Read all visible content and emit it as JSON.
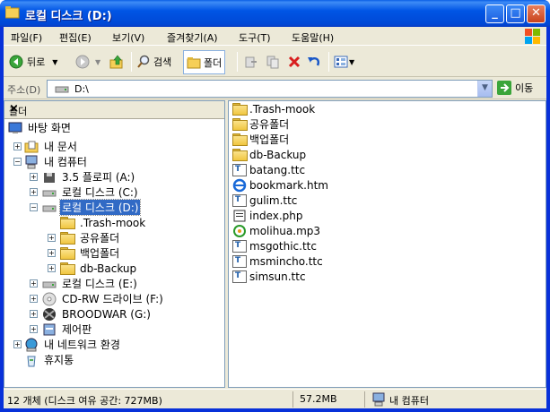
{
  "window": {
    "title": "로컬 디스크 (D:)"
  },
  "menu": [
    "파일(F)",
    "편집(E)",
    "보기(V)",
    "즐겨찾기(A)",
    "도구(T)",
    "도움말(H)"
  ],
  "toolbar": {
    "back": "뒤로",
    "search": "검색",
    "folders": "폴더"
  },
  "address": {
    "label": "주소(D)",
    "value": "D:\\",
    "go": "이동"
  },
  "folders_pane": {
    "title": "폴더"
  },
  "tree": [
    {
      "label": "바탕 화면",
      "icon": "desktop-icon"
    },
    {
      "label": "내 문서",
      "icon": "my-documents-icon"
    },
    {
      "label": "내 컴퓨터",
      "icon": "my-computer-icon"
    },
    {
      "label": "3.5 플로피 (A:)",
      "icon": "floppy-icon"
    },
    {
      "label": "로컬 디스크 (C:)",
      "icon": "drive-icon"
    },
    {
      "label": "로컬 디스크 (D:)",
      "icon": "drive-icon"
    },
    {
      "label": ".Trash-mook",
      "icon": "folder-icon"
    },
    {
      "label": "공유폴더",
      "icon": "folder-icon"
    },
    {
      "label": "백업폴더",
      "icon": "folder-icon"
    },
    {
      "label": "db-Backup",
      "icon": "folder-icon"
    },
    {
      "label": "로컬 디스크 (E:)",
      "icon": "drive-icon"
    },
    {
      "label": "CD-RW 드라이브 (F:)",
      "icon": "cd-icon"
    },
    {
      "label": "BROODWAR (G:)",
      "icon": "game-cd-icon"
    },
    {
      "label": "제어판",
      "icon": "control-panel-icon"
    },
    {
      "label": "내 네트워크 환경",
      "icon": "network-icon"
    },
    {
      "label": "휴지통",
      "icon": "recycle-bin-icon"
    }
  ],
  "files": [
    {
      "name": ".Trash-mook",
      "icon": "folder-icon"
    },
    {
      "name": "공유폴더",
      "icon": "folder-icon"
    },
    {
      "name": "백업폴더",
      "icon": "folder-icon"
    },
    {
      "name": "db-Backup",
      "icon": "folder-icon"
    },
    {
      "name": "batang.ttc",
      "icon": "font-icon"
    },
    {
      "name": "bookmark.htm",
      "icon": "ie-document-icon"
    },
    {
      "name": "gulim.ttc",
      "icon": "font-icon"
    },
    {
      "name": "index.php",
      "icon": "file-icon"
    },
    {
      "name": "molihua.mp3",
      "icon": "media-icon"
    },
    {
      "name": "msgothic.ttc",
      "icon": "font-icon"
    },
    {
      "name": "msmincho.ttc",
      "icon": "font-icon"
    },
    {
      "name": "simsun.ttc",
      "icon": "font-icon"
    }
  ],
  "status": {
    "count": "12 개체 (디스크 여유 공간: 727MB)",
    "size": "57.2MB",
    "location": "내 컴퓨터"
  },
  "colors": {
    "titlebar": "#0055e5",
    "selection": "#316ac5",
    "chrome": "#ece9d8"
  }
}
